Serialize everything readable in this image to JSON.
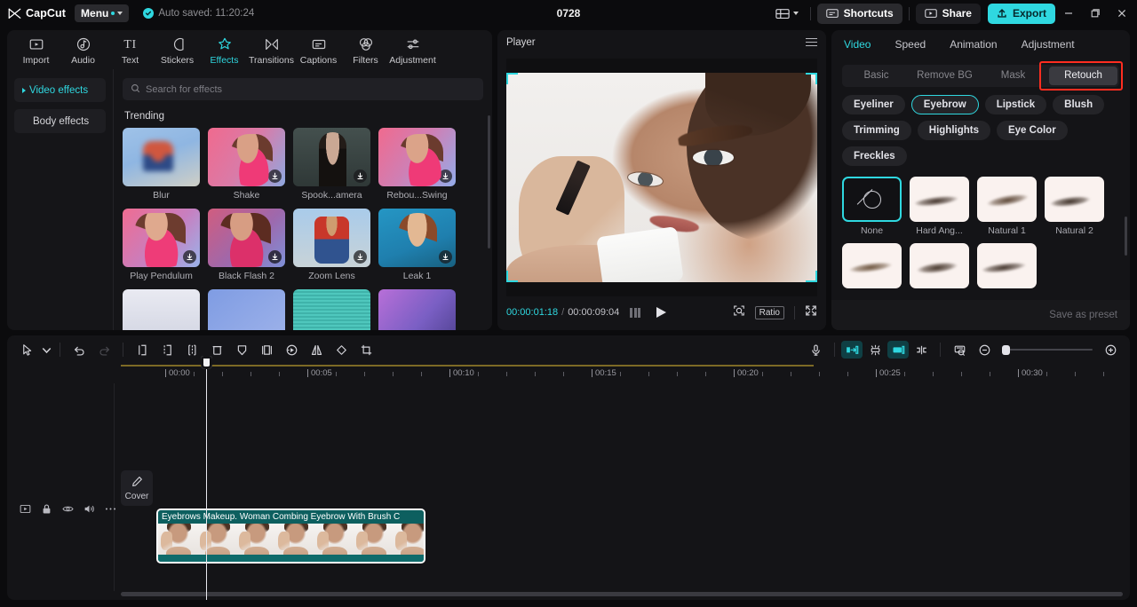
{
  "titlebar": {
    "brand": "CapCut",
    "menu_label": "Menu",
    "autosave": "Auto saved: 11:20:24",
    "project_name": "0728",
    "shortcuts_label": "Shortcuts",
    "share_label": "Share",
    "export_label": "Export",
    "accent": "#2fd8e0"
  },
  "toolbar": {
    "tabs": [
      {
        "label": "Import",
        "icon": "import-icon",
        "active": false
      },
      {
        "label": "Audio",
        "icon": "audio-icon",
        "active": false
      },
      {
        "label": "Text",
        "icon": "text-icon",
        "active": false
      },
      {
        "label": "Stickers",
        "icon": "stickers-icon",
        "active": false
      },
      {
        "label": "Effects",
        "icon": "effects-icon",
        "active": true
      },
      {
        "label": "Transitions",
        "icon": "transitions-icon",
        "active": false
      },
      {
        "label": "Captions",
        "icon": "captions-icon",
        "active": false
      },
      {
        "label": "Filters",
        "icon": "filters-icon",
        "active": false
      },
      {
        "label": "Adjustment",
        "icon": "adjustment-icon",
        "active": false
      }
    ]
  },
  "effects_panel": {
    "categories": [
      {
        "label": "Video effects",
        "active": true
      },
      {
        "label": "Body effects",
        "active": false
      }
    ],
    "search_placeholder": "Search for effects",
    "search_value": "",
    "section_title": "Trending",
    "items": [
      {
        "label": "Blur",
        "thumb": "t-blur",
        "download": false
      },
      {
        "label": "Shake",
        "thumb": "t-shake",
        "download": true
      },
      {
        "label": "Spook...amera",
        "thumb": "t-spook",
        "download": true
      },
      {
        "label": "Rebou...Swing",
        "thumb": "t-rebou",
        "download": true
      },
      {
        "label": "Play Pendulum",
        "thumb": "t-pend",
        "download": true
      },
      {
        "label": "Black Flash 2",
        "thumb": "t-bflash",
        "download": true
      },
      {
        "label": "Zoom Lens",
        "thumb": "t-zoom",
        "download": true
      },
      {
        "label": "Leak 1",
        "thumb": "t-leak",
        "download": true
      }
    ],
    "partial_row": [
      "t-r3a",
      "t-r3b",
      "t-r3c",
      "t-r3d"
    ]
  },
  "player": {
    "title": "Player",
    "current_time": "00:00:01:18",
    "time_separator": "/",
    "total_time": "00:00:09:04",
    "ratio_label": "Ratio"
  },
  "properties": {
    "tabs": [
      {
        "label": "Video",
        "active": true
      },
      {
        "label": "Speed",
        "active": false
      },
      {
        "label": "Animation",
        "active": false
      },
      {
        "label": "Adjustment",
        "active": false
      }
    ],
    "segments": [
      {
        "label": "Basic",
        "selected": false
      },
      {
        "label": "Remove BG",
        "selected": false
      },
      {
        "label": "Mask",
        "selected": false
      },
      {
        "label": "Retouch",
        "selected": true
      }
    ],
    "highlight_color": "#ff2d20",
    "chips": [
      {
        "label": "Eyeliner",
        "active": false
      },
      {
        "label": "Eyebrow",
        "active": true
      },
      {
        "label": "Lipstick",
        "active": false
      },
      {
        "label": "Blush",
        "active": false
      },
      {
        "label": "Trimming",
        "active": false
      },
      {
        "label": "Highlights",
        "active": false
      },
      {
        "label": "Eye Color",
        "active": false
      },
      {
        "label": "Freckles",
        "active": false
      }
    ],
    "presets": [
      {
        "label": "None",
        "kind": "none",
        "selected": true
      },
      {
        "label": "Hard Ang...",
        "kind": "brow",
        "art": "b2",
        "selected": false
      },
      {
        "label": "Natural 1",
        "kind": "brow",
        "art": "b3",
        "selected": false
      },
      {
        "label": "Natural 2",
        "kind": "brow",
        "art": "b4",
        "selected": false
      }
    ],
    "presets_partial": [
      "b5",
      "b6",
      "b2"
    ],
    "save_preset_label": "Save as preset"
  },
  "timeline": {
    "tool_icons": [
      "select-icon",
      "chevron-down-icon",
      "undo-icon",
      "redo-icon",
      "split-left-icon",
      "split-right-icon",
      "split-icon",
      "delete-icon",
      "freeze-icon",
      "crop-frame-icon",
      "reverse-icon",
      "mirror-icon",
      "rotate-icon",
      "crop-icon"
    ],
    "right_icons": [
      "mic-icon",
      "snap-start-icon",
      "auto-snap-icon",
      "snap-end-icon",
      "split-mark-icon",
      "preview-icon",
      "zoom-out-icon",
      "zoom-in-icon"
    ],
    "ruler_labels": [
      "00:00",
      "00:05",
      "00:10",
      "00:15",
      "00:20",
      "00:25",
      "00:30"
    ],
    "track_ctrl_icons": [
      "track-type-icon",
      "lock-icon",
      "eye-icon",
      "mute-icon",
      "more-icon"
    ],
    "cover_label": "Cover",
    "cover_icon": "pencil-icon",
    "clip_title": "Eyebrows Makeup. Woman Combing Eyebrow With Brush C",
    "clip_color": "#0f6b6b",
    "frame_count": 7,
    "playhead_time": "00:00:01:18"
  }
}
